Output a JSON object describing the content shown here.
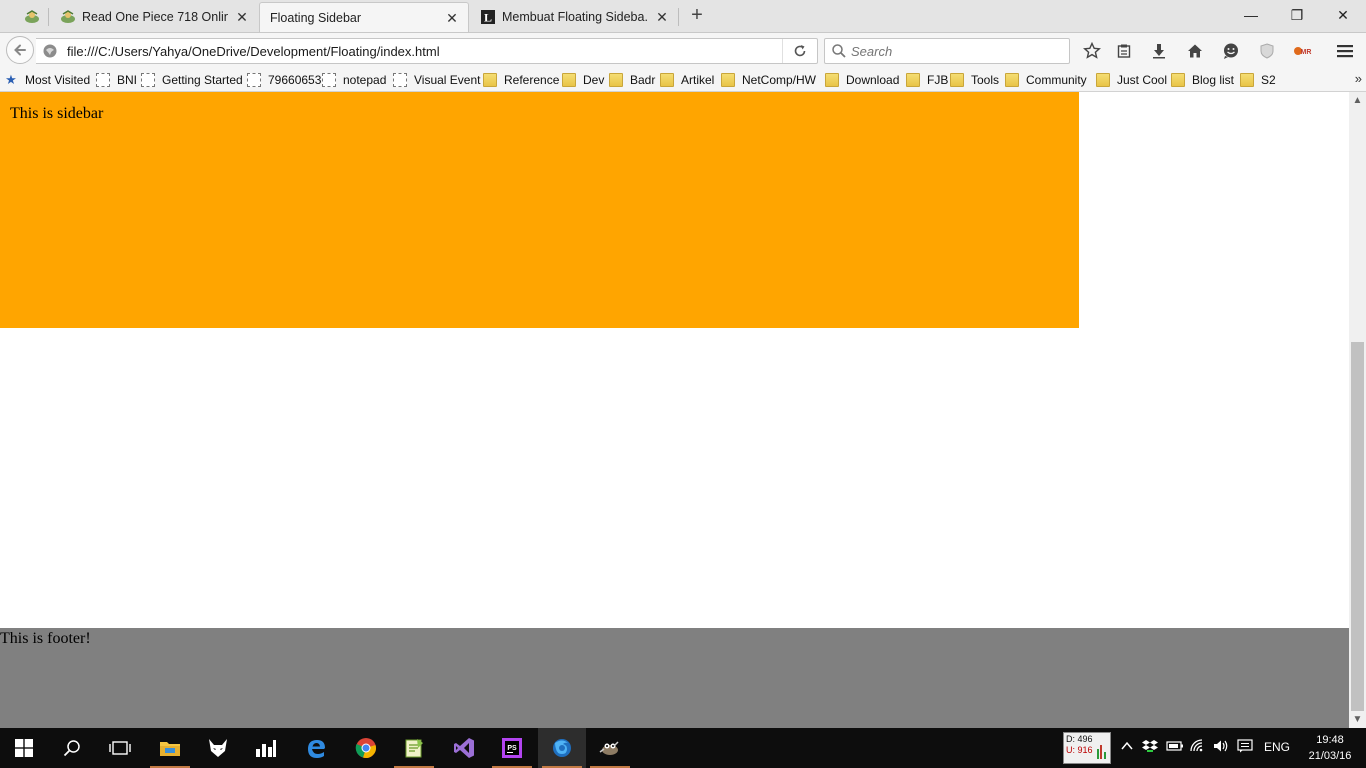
{
  "window": {
    "tabs": [
      {
        "label": "",
        "favicon": "leaf-favicon-icon"
      },
      {
        "label": "Read One Piece 718 Onlin...",
        "favicon": "leaf-favicon-icon"
      },
      {
        "label": "Floating Sidebar",
        "favicon": "",
        "active": true
      },
      {
        "label": "Membuat Floating Sideba...",
        "favicon": "L-logo-icon"
      }
    ],
    "new_tab_glyph": "+",
    "controls": {
      "minimize": "—",
      "restore": "❐",
      "close": "✕"
    }
  },
  "navbar": {
    "url": "file:///C:/Users/Yahya/OneDrive/Development/Floating/index.html",
    "search_placeholder": "Search"
  },
  "bookmarks": [
    {
      "label": "Most Visited",
      "icon": "star-icon"
    },
    {
      "label": "BNI",
      "icon": "page-icon"
    },
    {
      "label": "Getting Started",
      "icon": "page-icon"
    },
    {
      "label": "79660653",
      "icon": "page-icon"
    },
    {
      "label": "notepad",
      "icon": "page-icon"
    },
    {
      "label": "Visual Event",
      "icon": "page-icon"
    },
    {
      "label": "Reference",
      "icon": "folder-icon"
    },
    {
      "label": "Dev",
      "icon": "folder-icon"
    },
    {
      "label": "Badr",
      "icon": "folder-icon"
    },
    {
      "label": "Artikel",
      "icon": "folder-icon"
    },
    {
      "label": "NetComp/HW",
      "icon": "folder-icon"
    },
    {
      "label": "Download",
      "icon": "folder-icon"
    },
    {
      "label": "FJB",
      "icon": "folder-icon"
    },
    {
      "label": "Tools",
      "icon": "folder-icon"
    },
    {
      "label": "Community",
      "icon": "folder-icon"
    },
    {
      "label": "Just Cool",
      "icon": "folder-icon"
    },
    {
      "label": "Blog list",
      "icon": "folder-icon"
    },
    {
      "label": "S2",
      "icon": "folder-icon"
    }
  ],
  "bookmarks_overflow": "»",
  "page": {
    "sidebar_text": "This is sidebar",
    "footer_text": "This is footer!",
    "colors": {
      "sidebar": "#ffa500",
      "footer": "#808080"
    }
  },
  "taskbar": {
    "net_meter": {
      "down": "D: 496",
      "up": "U: 916"
    },
    "language": "ENG",
    "time": "19:48",
    "date": "21/03/16"
  }
}
